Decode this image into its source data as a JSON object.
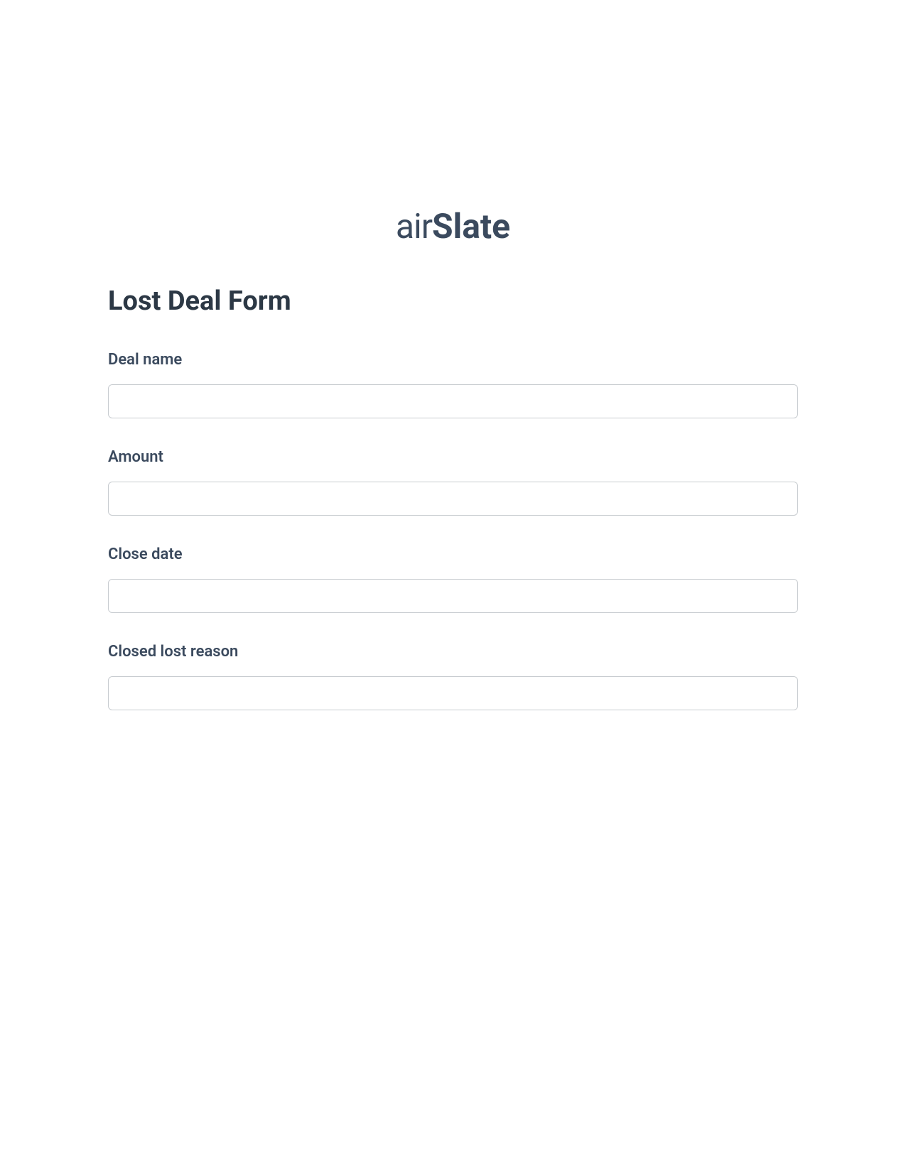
{
  "logo": {
    "part1": "air",
    "part2": "Slate"
  },
  "form": {
    "title": "Lost Deal Form",
    "fields": [
      {
        "label": "Deal name",
        "value": ""
      },
      {
        "label": "Amount",
        "value": ""
      },
      {
        "label": "Close date",
        "value": ""
      },
      {
        "label": "Closed lost reason",
        "value": ""
      }
    ]
  }
}
